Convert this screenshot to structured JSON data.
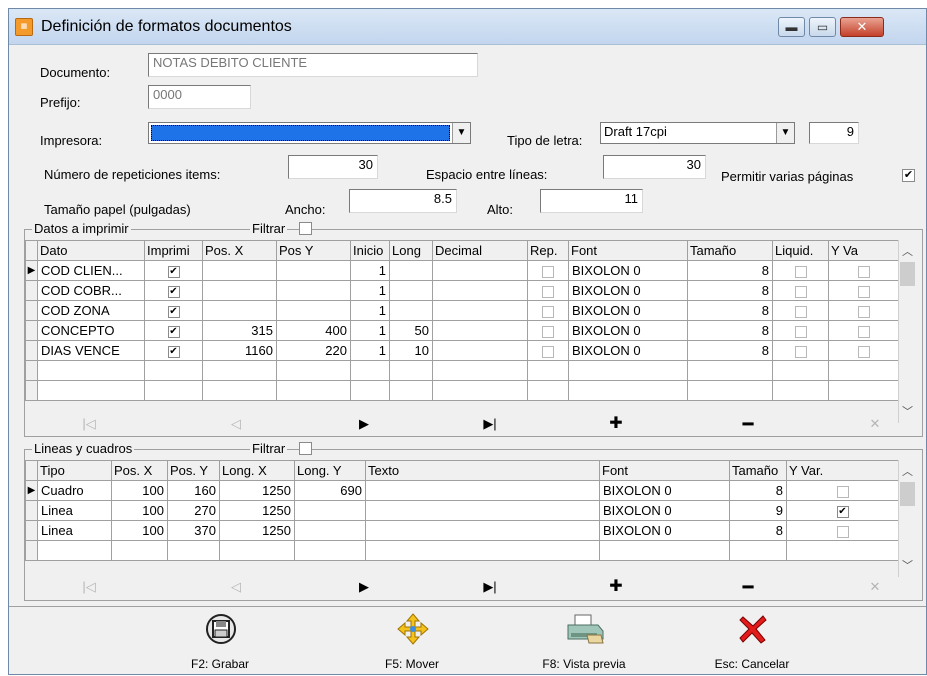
{
  "window": {
    "title": "Definición de formatos documentos",
    "icon": "app-icon"
  },
  "form": {
    "documento_label": "Documento:",
    "documento_value": "NOTAS DEBITO CLIENTE",
    "prefijo_label": "Prefijo:",
    "prefijo_value": "0000",
    "impresora_label": "Impresora:",
    "impresora_value": "",
    "tipo_letra_label": "Tipo de letra:",
    "tipo_letra_value": "Draft 17cpi",
    "tipo_letra_size": "9",
    "repeticiones_label": "Número de repeticiones items:",
    "repeticiones_value": "30",
    "espacio_label": "Espacio entre líneas:",
    "espacio_value": "30",
    "varias_paginas_label": "Permitir varias páginas",
    "varias_paginas_checked": true,
    "tamano_label": "Tamaño papel (pulgadas)",
    "ancho_label": "Ancho:",
    "ancho_value": "8.5",
    "alto_label": "Alto:",
    "alto_value": "11"
  },
  "datos": {
    "group_label": "Datos a imprimir",
    "filtrar_label": "Filtrar",
    "columns": [
      "Dato",
      "Imprimi",
      "Pos. X",
      "Pos Y",
      "Inicio",
      "Long",
      "Decimal",
      "Rep.",
      "Font",
      "Tamaño",
      "Liquid.",
      "Y Va"
    ],
    "rows": [
      {
        "dato": "COD CLIEN...",
        "imprimir": true,
        "pos_x": "",
        "pos_y": "",
        "inicio": "1",
        "long": "",
        "decimal": "",
        "rep": false,
        "font": "BIXOLON 0",
        "tamano": "8",
        "liquid": false,
        "yva": false,
        "current": true
      },
      {
        "dato": "COD COBR...",
        "imprimir": true,
        "pos_x": "",
        "pos_y": "",
        "inicio": "1",
        "long": "",
        "decimal": "",
        "rep": false,
        "font": "BIXOLON 0",
        "tamano": "8",
        "liquid": false,
        "yva": false,
        "current": false
      },
      {
        "dato": "COD ZONA",
        "imprimir": true,
        "pos_x": "",
        "pos_y": "",
        "inicio": "1",
        "long": "",
        "decimal": "",
        "rep": false,
        "font": "BIXOLON 0",
        "tamano": "8",
        "liquid": false,
        "yva": false,
        "current": false
      },
      {
        "dato": "CONCEPTO",
        "imprimir": true,
        "pos_x": "315",
        "pos_y": "400",
        "inicio": "1",
        "long": "50",
        "decimal": "",
        "rep": false,
        "font": "BIXOLON 0",
        "tamano": "8",
        "liquid": false,
        "yva": false,
        "current": false
      },
      {
        "dato": "DIAS VENCE",
        "imprimir": true,
        "pos_x": "1160",
        "pos_y": "220",
        "inicio": "1",
        "long": "10",
        "decimal": "",
        "rep": false,
        "font": "BIXOLON 0",
        "tamano": "8",
        "liquid": false,
        "yva": false,
        "current": false
      }
    ]
  },
  "lineas": {
    "group_label": "Lineas y cuadros",
    "filtrar_label": "Filtrar",
    "columns": [
      "Tipo",
      "Pos. X",
      "Pos. Y",
      "Long. X",
      "Long. Y",
      "Texto",
      "Font",
      "Tamaño",
      "Y Var."
    ],
    "rows": [
      {
        "tipo": "Cuadro",
        "pos_x": "100",
        "pos_y": "160",
        "long_x": "1250",
        "long_y": "690",
        "texto": "",
        "font": "BIXOLON 0",
        "tamano": "8",
        "yvar": false,
        "current": true
      },
      {
        "tipo": "Linea",
        "pos_x": "100",
        "pos_y": "270",
        "long_x": "1250",
        "long_y": "",
        "texto": "",
        "font": "BIXOLON 0",
        "tamano": "9",
        "yvar": true,
        "current": false
      },
      {
        "tipo": "Linea",
        "pos_x": "100",
        "pos_y": "370",
        "long_x": "1250",
        "long_y": "",
        "texto": "",
        "font": "BIXOLON 0",
        "tamano": "8",
        "yvar": false,
        "current": false
      }
    ]
  },
  "navigator": [
    "first-icon",
    "prior-icon",
    "next-icon",
    "last-icon",
    "insert-icon",
    "delete-icon",
    "cancel-edit-icon"
  ],
  "actions": [
    {
      "key": "grabar",
      "label": "F2: Grabar",
      "icon": "save-icon"
    },
    {
      "key": "mover",
      "label": "F5: Mover",
      "icon": "move-icon"
    },
    {
      "key": "vista",
      "label": "F8: Vista previa",
      "icon": "print-preview-icon"
    },
    {
      "key": "cancelar",
      "label": "Esc: Cancelar",
      "icon": "cancel-icon"
    }
  ]
}
